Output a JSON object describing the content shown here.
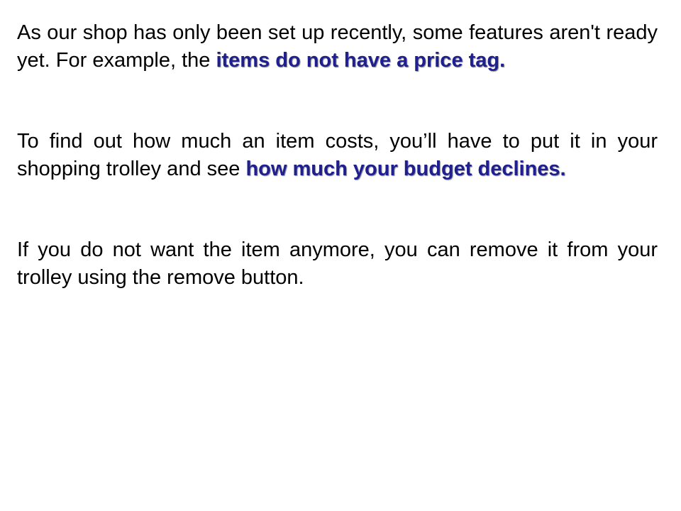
{
  "paragraphs": [
    {
      "pre": "As our shop has only been set up recently, some features aren't ready yet. For example, the ",
      "highlight": "items do not have a price tag.",
      "post": ""
    },
    {
      "pre": "To find out how much an item costs, you’ll have to put it in your shopping trolley and see ",
      "highlight": "how much your budget declines.",
      "post": ""
    },
    {
      "pre": "If you do not want the item anymore, you can remove it from your trolley using the remove button.",
      "highlight": "",
      "post": ""
    }
  ],
  "colors": {
    "text": "#000000",
    "highlight": "#1f1f8f",
    "background": "#ffffff"
  }
}
